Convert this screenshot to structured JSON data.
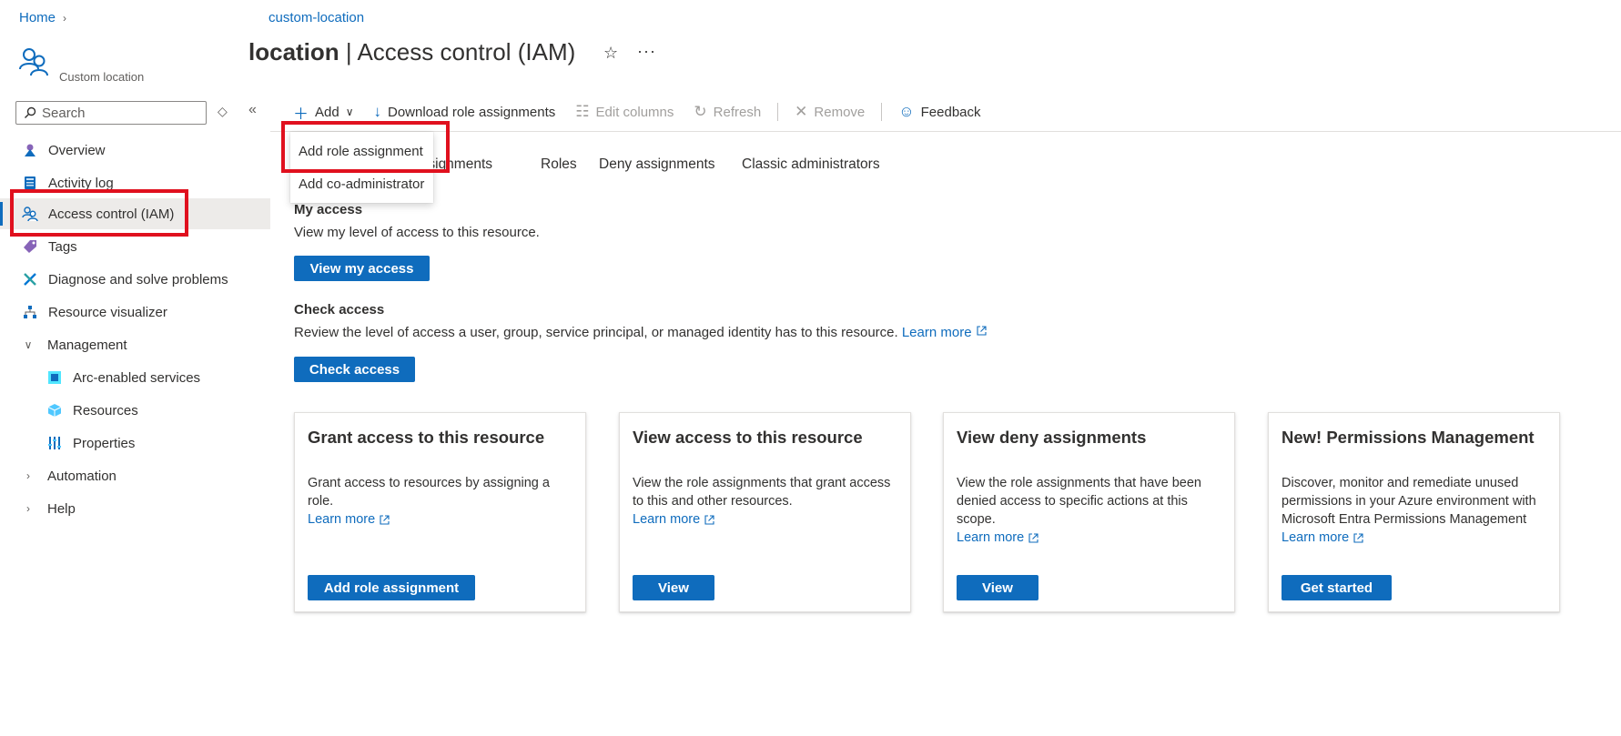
{
  "breadcrumb": {
    "home": "Home",
    "resource": "custom-location"
  },
  "resource": {
    "type": "Custom location",
    "title_bold": "location",
    "title_rest": "| Access control (IAM)"
  },
  "sidebar": {
    "search_placeholder": "Search",
    "items": [
      {
        "label": "Overview",
        "icon": "overview-icon"
      },
      {
        "label": "Activity log",
        "icon": "activity-log-icon"
      },
      {
        "label": "Access control (IAM)",
        "icon": "iam-icon",
        "selected": true
      },
      {
        "label": "Tags",
        "icon": "tag-icon"
      },
      {
        "label": "Diagnose and solve problems",
        "icon": "wrench-icon"
      },
      {
        "label": "Resource visualizer",
        "icon": "visualizer-icon"
      },
      {
        "label": "Management",
        "icon": "chevron-down-icon",
        "expanded": true
      },
      {
        "label": "Arc-enabled services",
        "icon": "arc-icon"
      },
      {
        "label": "Resources",
        "icon": "cube-icon"
      },
      {
        "label": "Properties",
        "icon": "properties-icon"
      },
      {
        "label": "Automation",
        "icon": "chevron-right-icon"
      },
      {
        "label": "Help",
        "icon": "chevron-right-icon"
      }
    ]
  },
  "toolbar": {
    "add": "Add",
    "download": "Download role assignments",
    "edit_columns": "Edit columns",
    "refresh": "Refresh",
    "remove": "Remove",
    "feedback": "Feedback"
  },
  "dropdown": {
    "items": [
      "Add role assignment",
      "Add co-administrator"
    ]
  },
  "tabs": [
    "assignments",
    "Roles",
    "Deny assignments",
    "Classic administrators"
  ],
  "my_access": {
    "heading": "My access",
    "text": "View my level of access to this resource.",
    "button": "View my access"
  },
  "check_access": {
    "heading": "Check access",
    "text": "Review the level of access a user, group, service principal, or managed identity has to this resource.",
    "link": "Learn more",
    "button": "Check access"
  },
  "cards": [
    {
      "title": "Grant access to this resource",
      "desc": "Grant access to resources by assigning a role.",
      "link": "Learn more",
      "button": "Add role assignment"
    },
    {
      "title": "View access to this resource",
      "desc": "View the role assignments that grant access to this and other resources.",
      "link": "Learn more",
      "button": "View"
    },
    {
      "title": "View deny assignments",
      "desc": "View the role assignments that have been denied access to specific actions at this scope.",
      "link": "Learn more",
      "button": "View"
    },
    {
      "title": "New! Permissions Management",
      "desc": "Discover, monitor and remediate unused permissions in your Azure environment with Microsoft Entra Permissions Management",
      "link": "Learn more",
      "button": "Get started"
    }
  ],
  "colors": {
    "accent": "#0f6cbd",
    "highlight": "#e0101e",
    "selected_bg": "#edebe9"
  }
}
